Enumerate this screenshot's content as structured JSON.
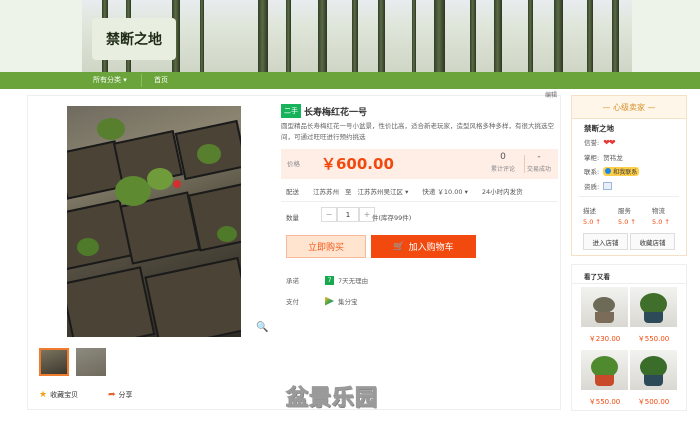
{
  "header": {
    "shop_name": "禁断之地",
    "nav": [
      "所有分类 ▾",
      "首页"
    ]
  },
  "edit_label": "编辑",
  "product": {
    "tag": "二手",
    "title": "长寿梅红花一号",
    "description": "圆型精品长寿梅红花一号小盆景，性价比高，适合新老玩家，造型风格多种多样，有很大挑选空间，可通过旺旺进行预约挑选",
    "price_label": "价格",
    "price": "￥600.00",
    "stats": [
      {
        "value": "0",
        "label": "累计评论"
      },
      {
        "value": "-",
        "label": "交易成功"
      }
    ],
    "shipping": {
      "label": "配送",
      "from": "江苏苏州",
      "to_word": "至",
      "to": "江苏苏州吴江区 ▾",
      "fee": "快递 ￥10.00 ▾",
      "time": "24小时内发货"
    },
    "quantity": {
      "label": "数量",
      "minus": "−",
      "value": "1",
      "plus": "+",
      "stock": "件(库存99件)"
    },
    "buy_now": "立即购买",
    "add_to_cart": "加入购物车",
    "promise": {
      "label": "承诺",
      "value": "7天无理由"
    },
    "payment": {
      "label": "支付",
      "value": "集分宝"
    },
    "favorite": "收藏宝贝",
    "share": "分享"
  },
  "seller": {
    "heading": "— 心级卖家 —",
    "name": "禁断之地",
    "credit_label": "信誉:",
    "hearts": "❤❤",
    "keeper_label": "掌柜:",
    "keeper": "贺祎龙",
    "contact_label": "联系:",
    "contact": "和我联系",
    "qual_label": "资质:",
    "scores": [
      {
        "label": "描述",
        "value": "5.0 ↑"
      },
      {
        "label": "服务",
        "value": "5.0 ↑"
      },
      {
        "label": "物流",
        "value": "5.0 ↑"
      }
    ],
    "enter_shop": "进入店铺",
    "fav_shop": "收藏店铺"
  },
  "also_viewed": {
    "heading": "看了又看",
    "items": [
      {
        "price": "￥230.00"
      },
      {
        "price": "￥550.00"
      },
      {
        "price": "￥550.00"
      },
      {
        "price": "￥500.00"
      }
    ]
  },
  "watermark": "盆景乐园",
  "colors": {
    "nav_green": "#6aa43a",
    "price_orange": "#f24a0e",
    "secondhand_tag": "#17b35a",
    "seller_gold": "#d6912b"
  }
}
